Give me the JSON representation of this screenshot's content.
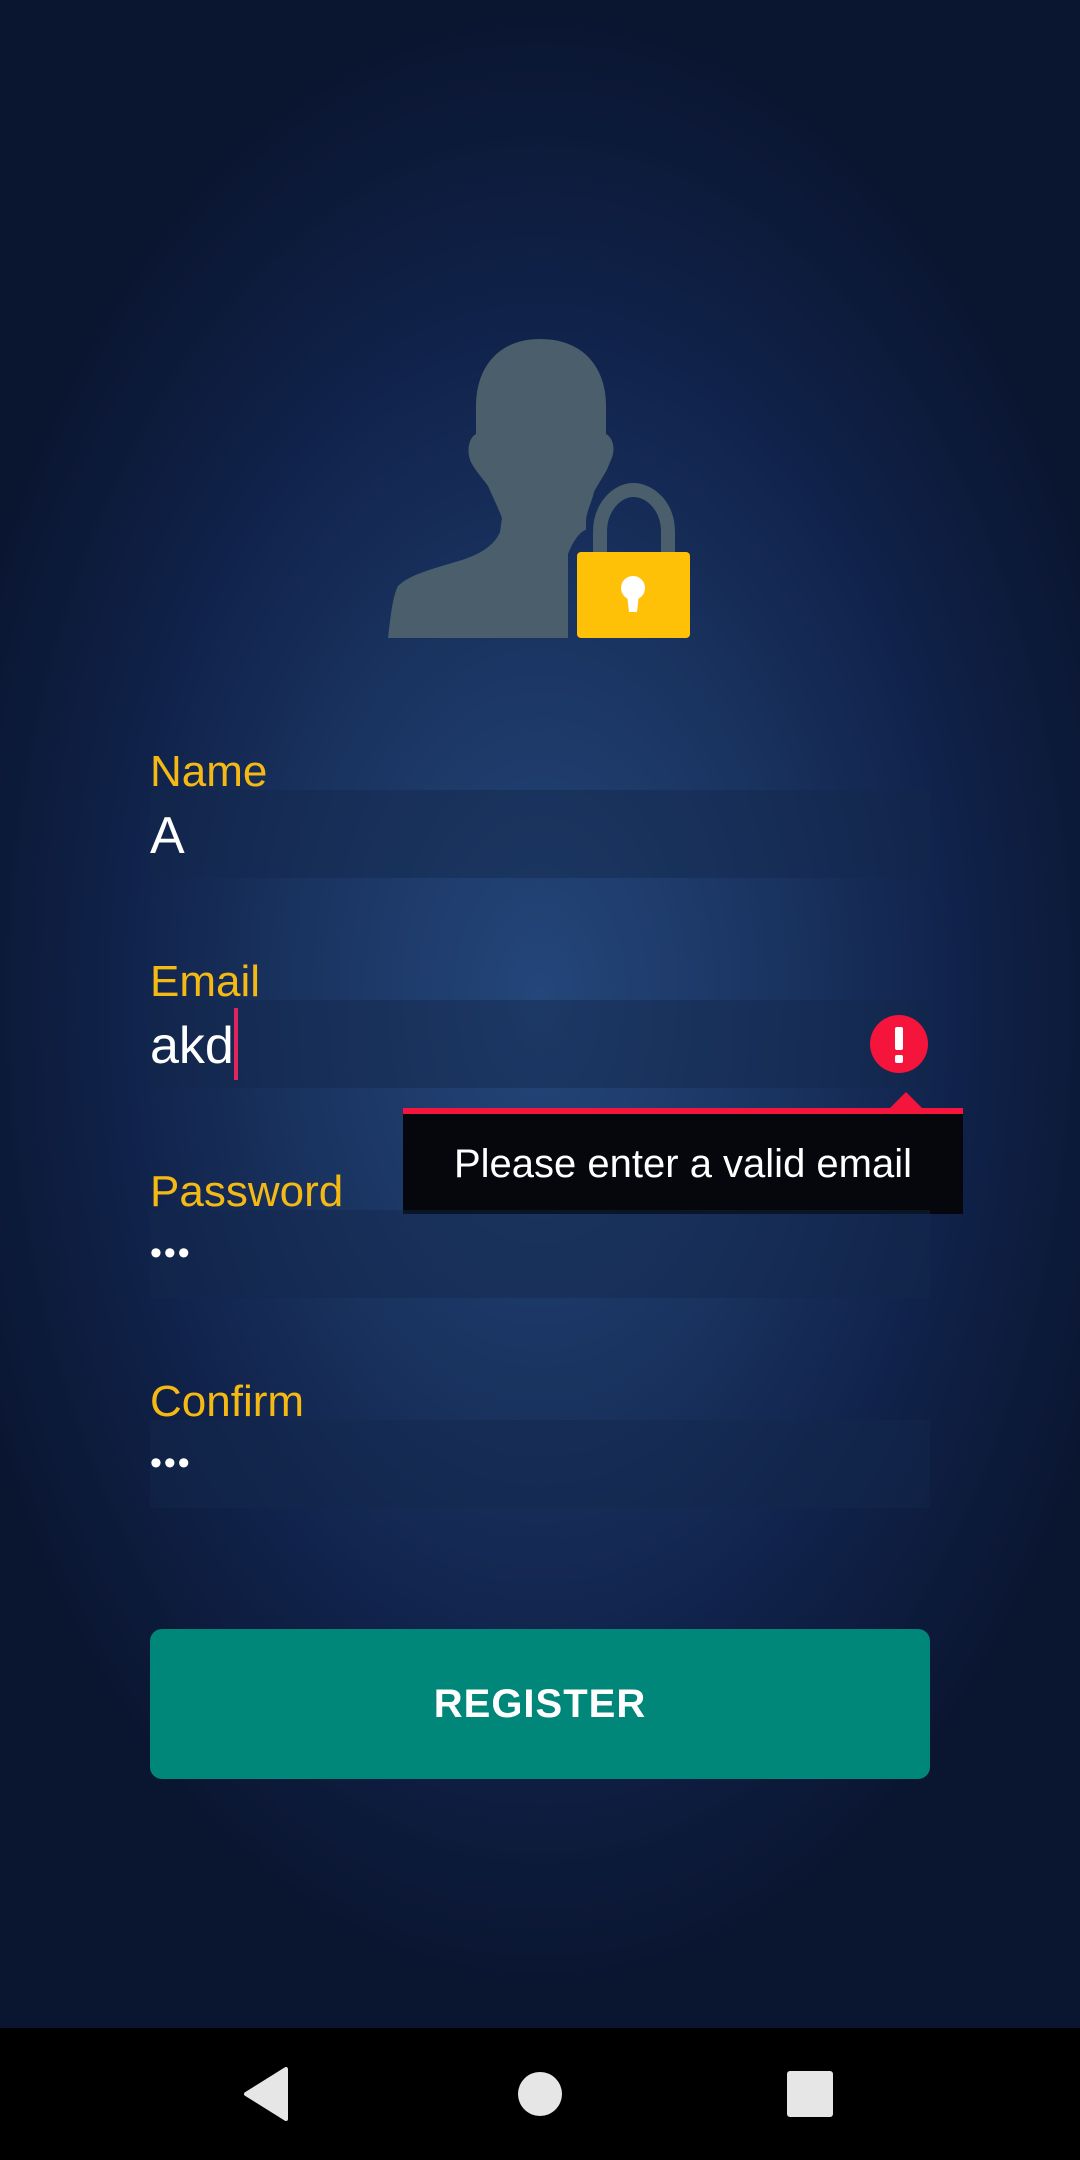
{
  "form": {
    "name": {
      "label": "Name",
      "value": "A"
    },
    "email": {
      "label": "Email",
      "value": "akd",
      "error": "Please enter a valid email"
    },
    "password": {
      "label": "Password",
      "value": "•••"
    },
    "confirm": {
      "label": "Confirm",
      "value": "•••"
    },
    "register_label": "REGISTER"
  },
  "icons": {
    "avatar": "user-lock-icon",
    "error": "error-icon",
    "nav_back": "back-icon",
    "nav_home": "home-icon",
    "nav_recents": "recents-icon"
  },
  "colors": {
    "label": "#f5b914",
    "button": "#01877a",
    "error": "#f4143c",
    "lock": "#ffc107",
    "silhouette": "#4a5f6b"
  }
}
